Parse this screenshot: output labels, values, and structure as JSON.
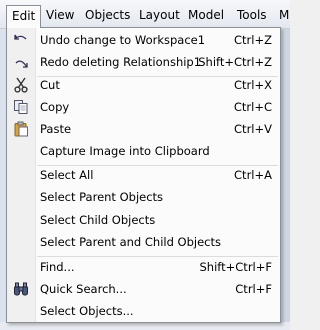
{
  "menubar": {
    "items": [
      "Edit",
      "View",
      "Objects",
      "Layout",
      "Model",
      "Tools",
      "M"
    ]
  },
  "edit_menu": {
    "items": [
      {
        "label": "Undo change to Workspace1",
        "shortcut": "Ctrl+Z",
        "icon": "undo-icon"
      },
      {
        "label": "Redo deleting Relationship1",
        "shortcut": "Shift+Ctrl+Z",
        "icon": "redo-icon"
      },
      {
        "label": "Cut",
        "shortcut": "Ctrl+X",
        "icon": "cut-icon"
      },
      {
        "label": "Copy",
        "shortcut": "Ctrl+C",
        "icon": "copy-icon"
      },
      {
        "label": "Paste",
        "shortcut": "Ctrl+V",
        "icon": "paste-icon"
      },
      {
        "label": "Capture Image into Clipboard",
        "shortcut": ""
      },
      {
        "label": "Select All",
        "shortcut": "Ctrl+A"
      },
      {
        "label": "Select Parent Objects",
        "shortcut": ""
      },
      {
        "label": "Select Child Objects",
        "shortcut": ""
      },
      {
        "label": "Select Parent and Child Objects",
        "shortcut": ""
      },
      {
        "label": "Find...",
        "shortcut": "Shift+Ctrl+F"
      },
      {
        "label": "Quick Search...",
        "shortcut": "Ctrl+F",
        "icon": "binoculars-icon"
      },
      {
        "label": "Select Objects...",
        "shortcut": ""
      }
    ]
  }
}
